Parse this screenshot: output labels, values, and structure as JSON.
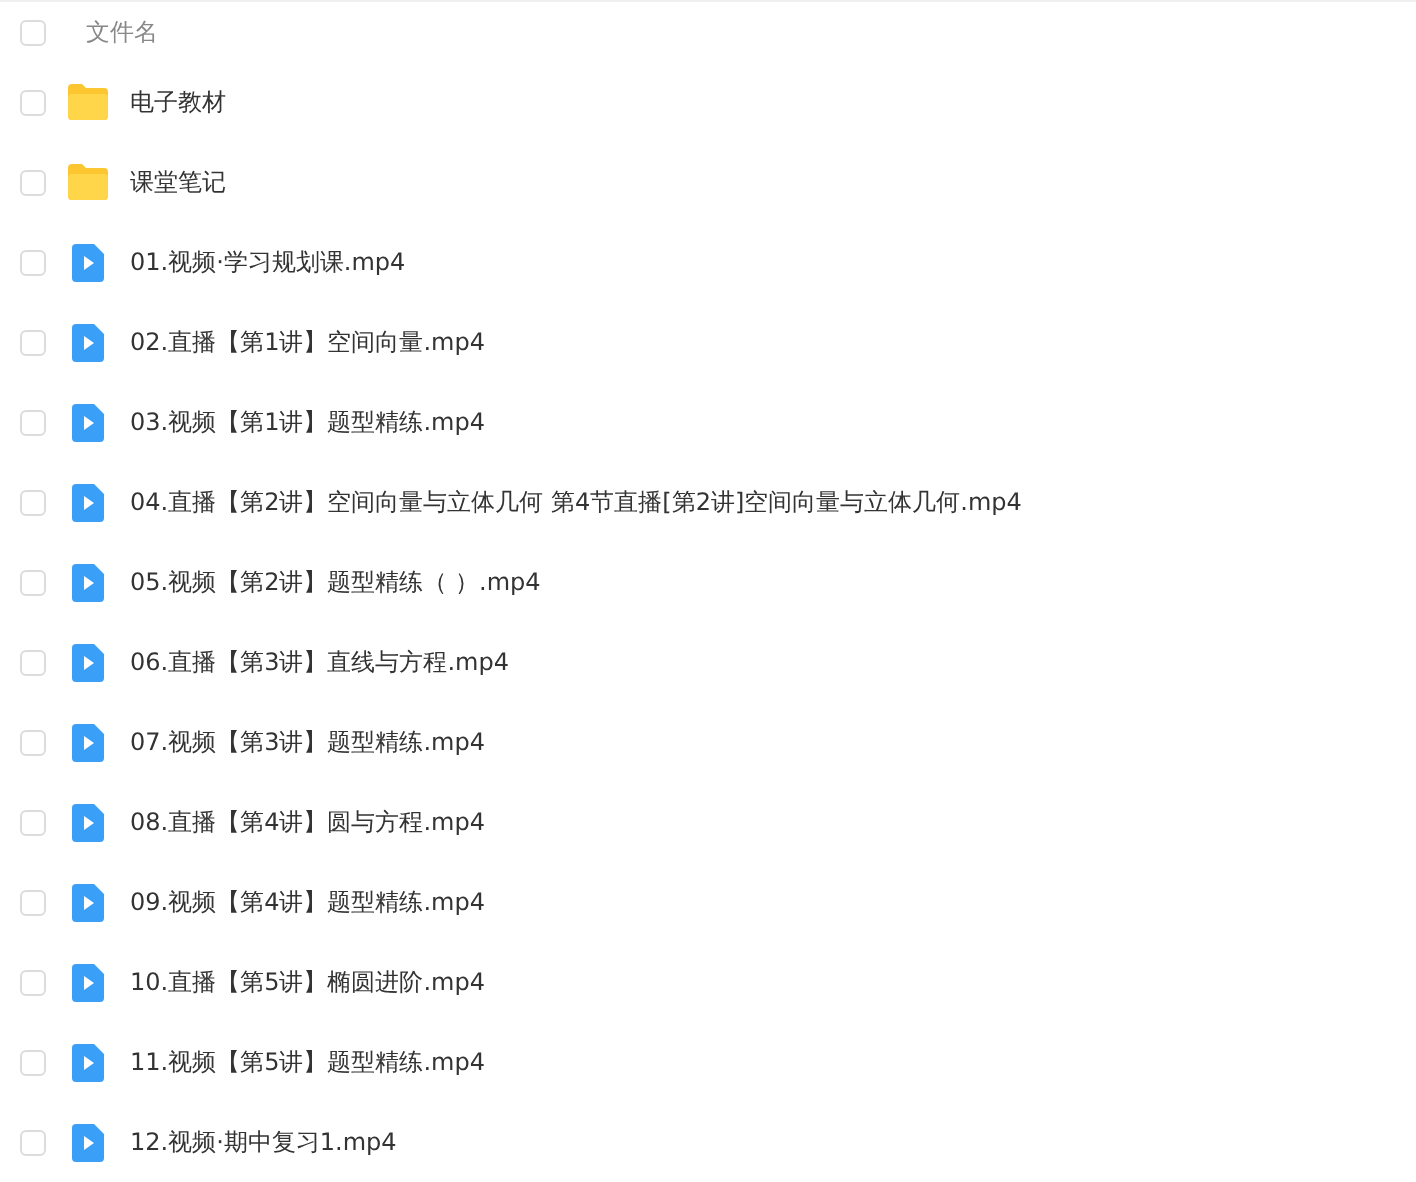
{
  "header": {
    "checked": false,
    "column_1": "文件名"
  },
  "files": [
    {
      "kind": "folder",
      "name": "电子教材",
      "checked": false
    },
    {
      "kind": "folder",
      "name": "课堂笔记",
      "checked": false
    },
    {
      "kind": "video",
      "name": "01.视频·学习规划课.mp4",
      "checked": false
    },
    {
      "kind": "video",
      "name": "02.直播【第1讲】空间向量.mp4",
      "checked": false
    },
    {
      "kind": "video",
      "name": "03.视频【第1讲】题型精练.mp4",
      "checked": false
    },
    {
      "kind": "video",
      "name": "04.直播【第2讲】空间向量与立体几何 第4节直播[第2讲]空间向量与立体几何.mp4",
      "checked": false
    },
    {
      "kind": "video",
      "name": "05.视频【第2讲】题型精练（ ）.mp4",
      "checked": false
    },
    {
      "kind": "video",
      "name": "06.直播【第3讲】直线与方程.mp4",
      "checked": false
    },
    {
      "kind": "video",
      "name": "07.视频【第3讲】题型精练.mp4",
      "checked": false
    },
    {
      "kind": "video",
      "name": "08.直播【第4讲】圆与方程.mp4",
      "checked": false
    },
    {
      "kind": "video",
      "name": "09.视频【第4讲】题型精练.mp4",
      "checked": false
    },
    {
      "kind": "video",
      "name": "10.直播【第5讲】椭圆进阶.mp4",
      "checked": false
    },
    {
      "kind": "video",
      "name": "11.视频【第5讲】题型精练.mp4",
      "checked": false
    },
    {
      "kind": "video",
      "name": "12.视频·期中复习1.mp4",
      "checked": false
    }
  ]
}
